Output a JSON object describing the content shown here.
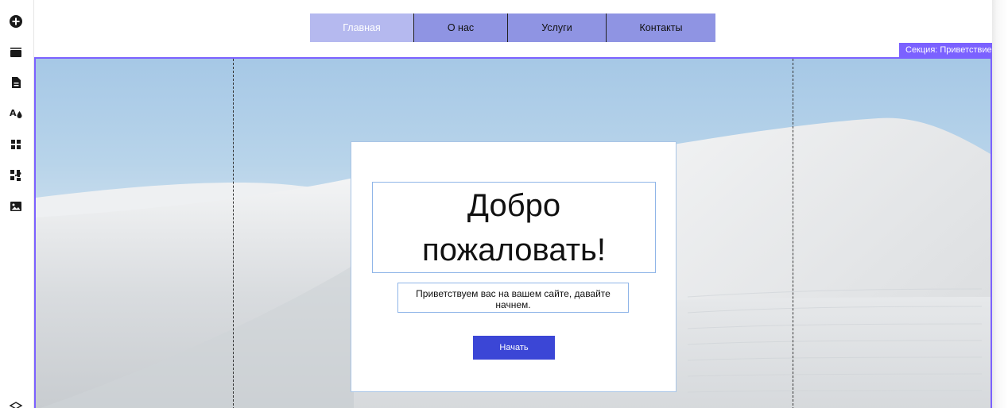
{
  "toolbar": {
    "items": [
      {
        "name": "add-icon"
      },
      {
        "name": "sections-icon"
      },
      {
        "name": "pages-icon"
      },
      {
        "name": "theme-icon"
      },
      {
        "name": "apps-icon"
      },
      {
        "name": "add-apps-icon"
      },
      {
        "name": "media-icon"
      }
    ]
  },
  "nav": {
    "items": [
      {
        "label": "Главная",
        "active": true
      },
      {
        "label": "О нас",
        "active": false
      },
      {
        "label": "Услуги",
        "active": false
      },
      {
        "label": "Контакты",
        "active": false
      }
    ]
  },
  "section": {
    "label": "Секция: Приветствие",
    "headline_line1": "Добро",
    "headline_line2": "пожаловать!",
    "subtitle": "Приветствуем вас на вашем сайте, давайте начнем.",
    "button_label": "Начать"
  },
  "colors": {
    "accent": "#7b61ff",
    "nav_bg": "#8f94e3",
    "nav_active": "#b5b9ef",
    "button": "#3b46d6"
  }
}
